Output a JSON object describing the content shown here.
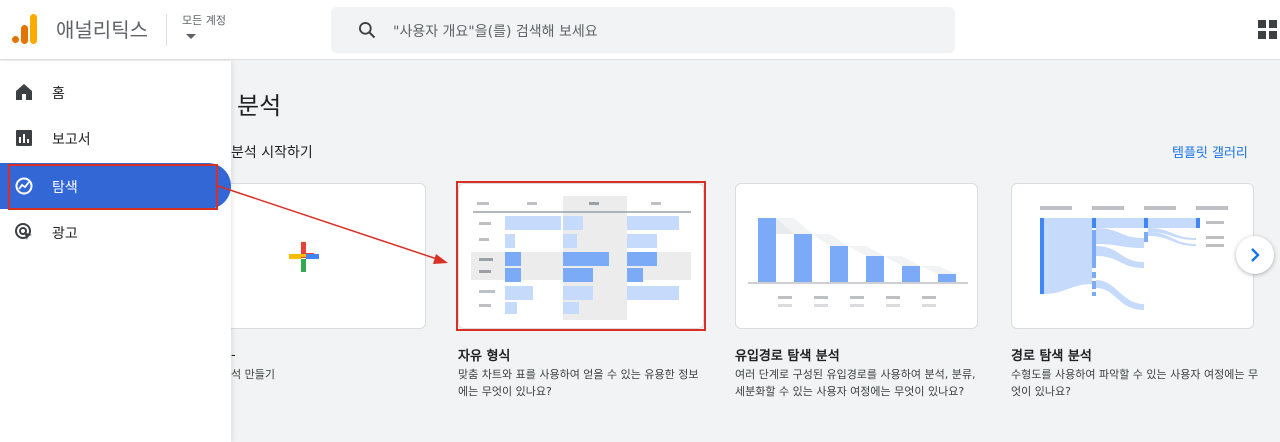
{
  "header": {
    "app_title": "애널리틱스",
    "account_label": "모든 계정",
    "search_placeholder": "\"사용자 개요\"을(를) 검색해 보세요"
  },
  "sidebar": {
    "items": [
      {
        "label": "홈",
        "icon": "home-icon"
      },
      {
        "label": "보고서",
        "icon": "bar-chart-icon"
      },
      {
        "label": "탐색",
        "icon": "explore-icon",
        "active": true
      },
      {
        "label": "광고",
        "icon": "ads-target-icon"
      }
    ]
  },
  "main": {
    "title": "분석",
    "start_heading": "분석 시작하기",
    "gallery_link": "템플릿 갤러리",
    "cards": [
      {
        "title": "",
        "desc": "석 만들기"
      },
      {
        "title": "자유 형식",
        "desc": "맞춤 차트와 표를 사용하여 얻을 수 있는 유용한 정보에는 무엇이 있나요?"
      },
      {
        "title": "유입경로 탐색 분석",
        "desc": "여러 단계로 구성된 유입경로를 사용하여 분석, 분류, 세분화할 수 있는 사용자 여정에는 무엇이 있나요?"
      },
      {
        "title": "경로 탐색 분석",
        "desc": "수형도를 사용하여 파악할 수 있는 사용자 여정에는 무엇이 있나요?"
      }
    ]
  },
  "colors": {
    "accent": "#1a73e8",
    "active_nav": "#3367d6",
    "highlight": "#d93025",
    "chart_blue": "#7baaf7",
    "chart_light": "#c6dafc"
  }
}
